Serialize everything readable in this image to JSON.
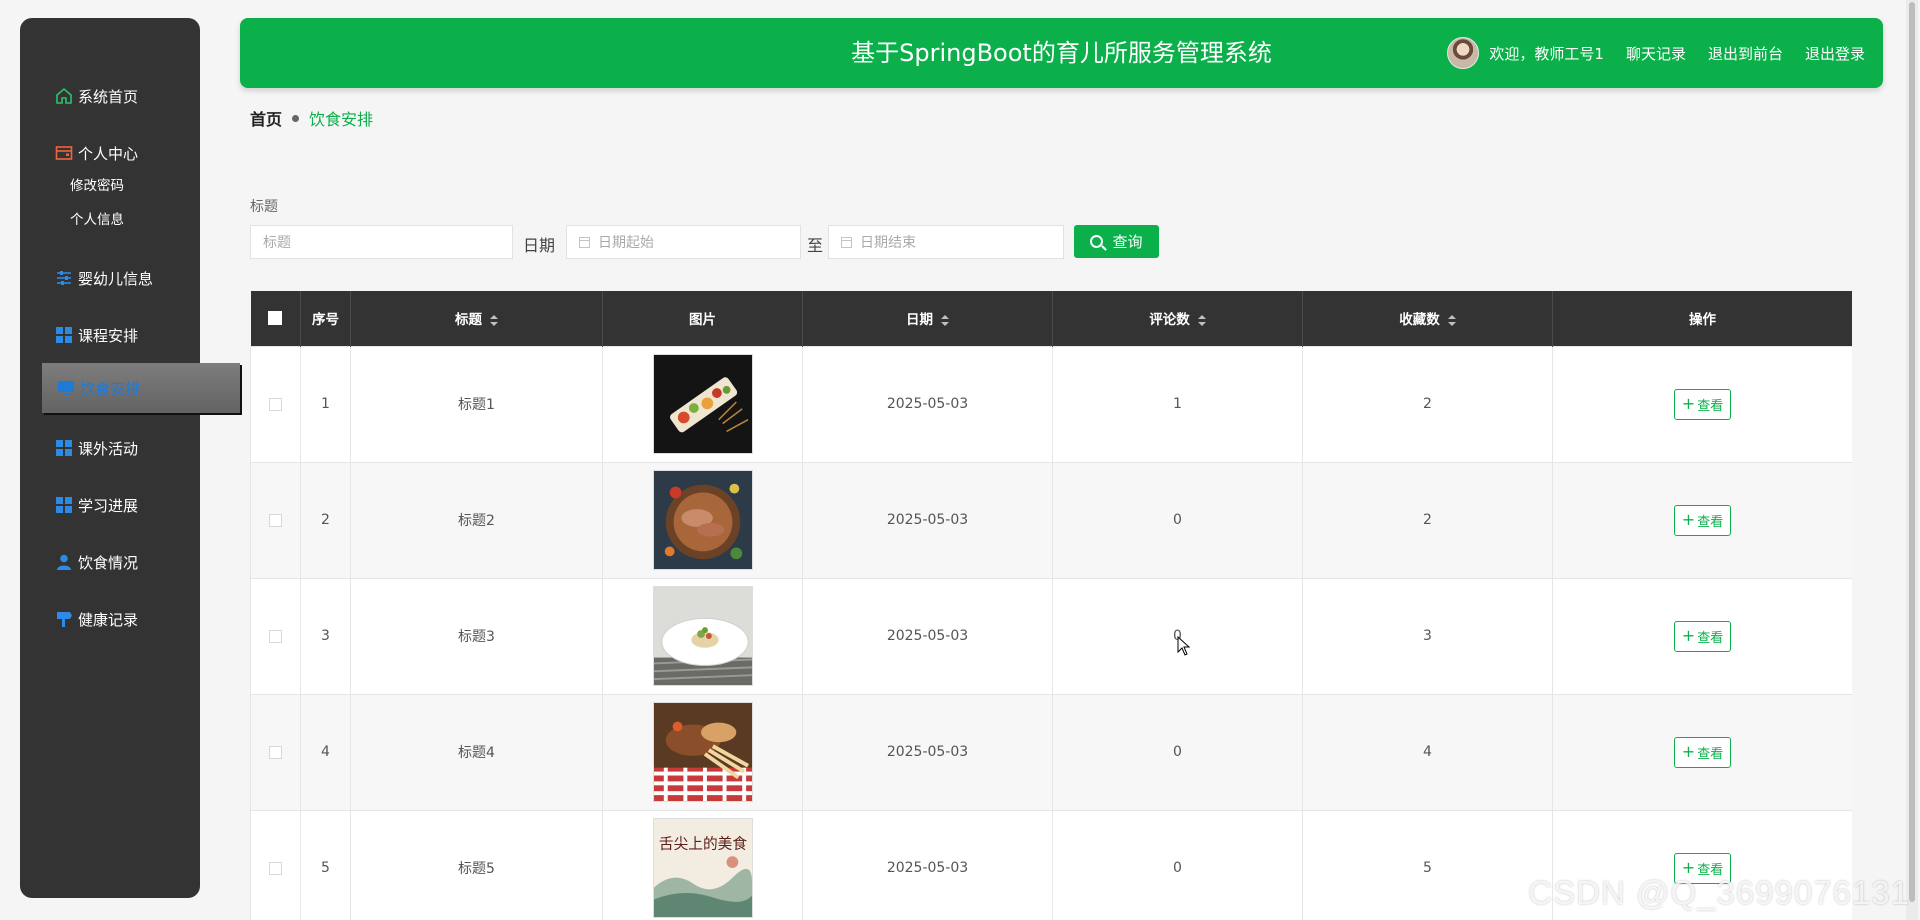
{
  "app": {
    "title": "基于SpringBoot的育儿所服务管理系统"
  },
  "header": {
    "welcome": "欢迎，教师工号1",
    "links": [
      "聊天记录",
      "退出到前台",
      "退出登录"
    ]
  },
  "sidebar": {
    "items": [
      {
        "label": "系统首页",
        "icon": "home-icon"
      },
      {
        "label": "个人中心",
        "icon": "wallet-icon"
      },
      {
        "label": "婴幼儿信息",
        "icon": "sliders-icon"
      },
      {
        "label": "课程安排",
        "icon": "grid-icon"
      },
      {
        "label": "饮食安排",
        "icon": "monitor-icon",
        "active": true
      },
      {
        "label": "课外活动",
        "icon": "grid-icon"
      },
      {
        "label": "学习进展",
        "icon": "grid-icon"
      },
      {
        "label": "饮食情况",
        "icon": "user-icon"
      },
      {
        "label": "健康记录",
        "icon": "signpost-icon"
      }
    ],
    "subitems": [
      "修改密码",
      "个人信息"
    ]
  },
  "breadcrumb": {
    "home": "首页",
    "current": "饮食安排"
  },
  "search": {
    "title_label": "标题",
    "title_placeholder": "标题",
    "date_label": "日期",
    "date_start_placeholder": "日期起始",
    "date_to": "至",
    "date_end_placeholder": "日期结束",
    "button": "查询"
  },
  "table": {
    "headers": [
      "序号",
      "标题",
      "图片",
      "日期",
      "评论数",
      "收藏数",
      "操作"
    ],
    "rows": [
      {
        "no": "1",
        "title": "标题1",
        "date": "2025-05-03",
        "comments": "1",
        "favorites": "2",
        "action": "查看"
      },
      {
        "no": "2",
        "title": "标题2",
        "date": "2025-05-03",
        "comments": "0",
        "favorites": "2",
        "action": "查看"
      },
      {
        "no": "3",
        "title": "标题3",
        "date": "2025-05-03",
        "comments": "0",
        "favorites": "3",
        "action": "查看"
      },
      {
        "no": "4",
        "title": "标题4",
        "date": "2025-05-03",
        "comments": "0",
        "favorites": "4",
        "action": "查看"
      },
      {
        "no": "5",
        "title": "标题5",
        "date": "2025-05-03",
        "comments": "0",
        "favorites": "5",
        "action": "查看"
      }
    ]
  },
  "thumb5_text": "舌尖上的美食",
  "watermark": "CSDN @Q_3699076131",
  "colors": {
    "accent": "#0bb04a",
    "sidebar": "#333333",
    "active_text": "#1e7ad8"
  }
}
